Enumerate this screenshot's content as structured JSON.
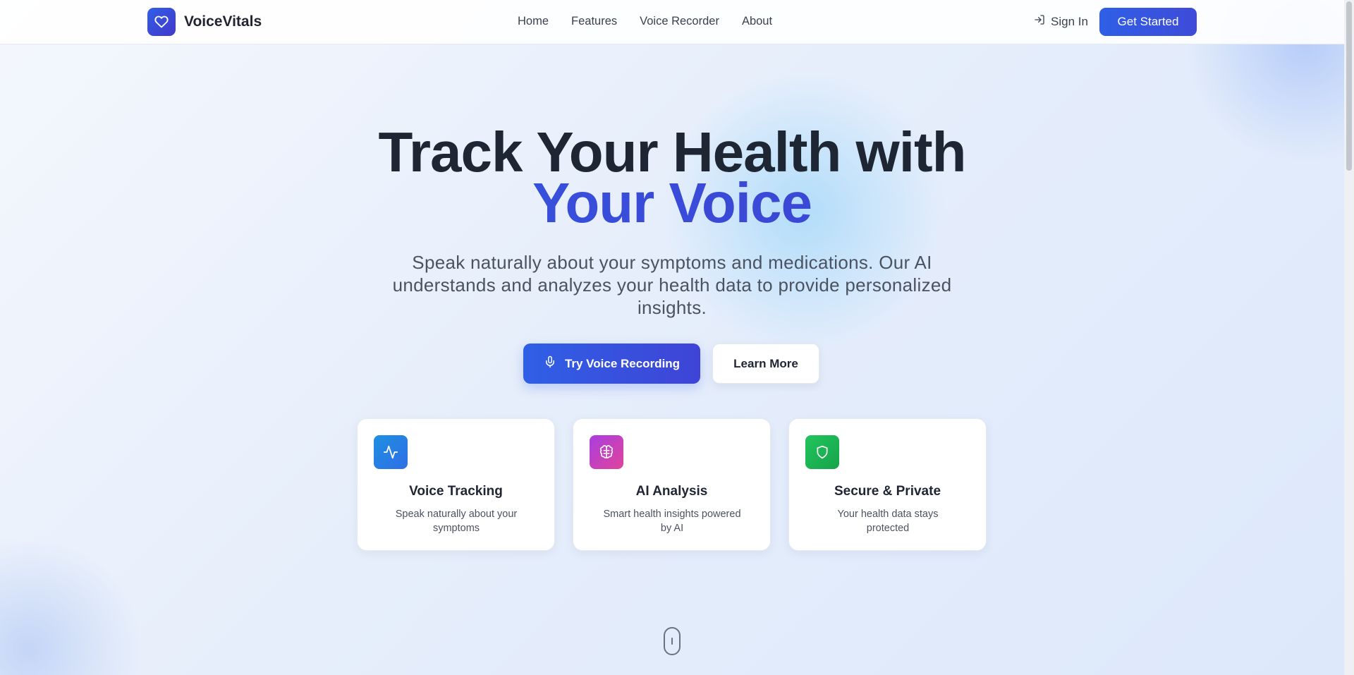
{
  "header": {
    "brand": "VoiceVitals",
    "nav": [
      "Home",
      "Features",
      "Voice Recorder",
      "About"
    ],
    "sign_in": "Sign In",
    "get_started": "Get Started"
  },
  "hero": {
    "title_line1": "Track Your Health with",
    "title_accent": "Your Voice",
    "subtitle": "Speak naturally about your symptoms and medications. Our AI understands and analyzes your health data to provide personalized insights.",
    "primary_button": "Try Voice Recording",
    "secondary_button": "Learn More"
  },
  "features": [
    {
      "title": "Voice Tracking",
      "description": "Speak naturally about your symptoms",
      "icon": "activity-icon",
      "color": "#1e8fe0"
    },
    {
      "title": "AI Analysis",
      "description": "Smart health insights powered by AI",
      "icon": "brain-icon",
      "color": "#c13fd6"
    },
    {
      "title": "Secure & Private",
      "description": "Your health data stays protected",
      "icon": "shield-icon",
      "color": "#1fbf5e"
    }
  ],
  "colors": {
    "accent": "#2f5fe6",
    "accent_dark": "#4338ca",
    "text": "#1e2533"
  }
}
